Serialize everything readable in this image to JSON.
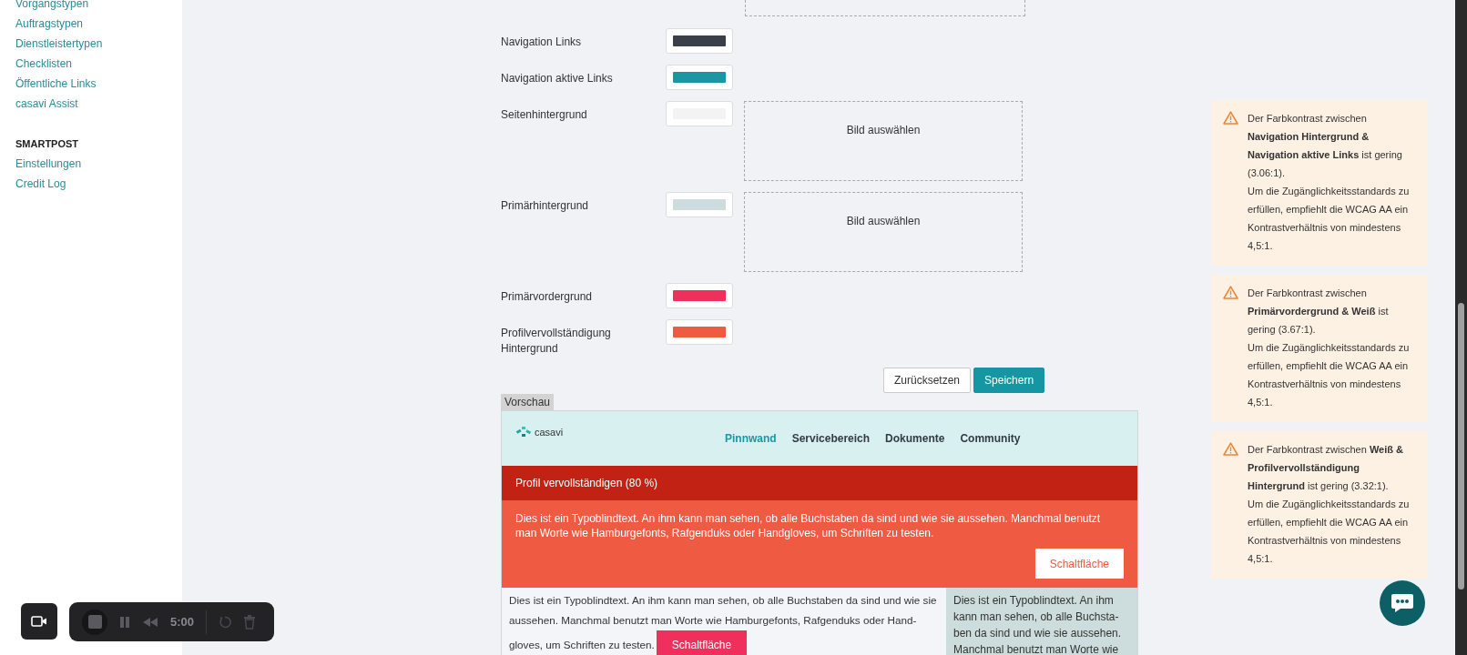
{
  "sidebar": {
    "groups": [
      {
        "items": [
          {
            "label": "Vorgangstypen"
          },
          {
            "label": "Auftragstypen"
          },
          {
            "label": "Dienstleistertypen"
          },
          {
            "label": "Checklisten"
          },
          {
            "label": "Öffentliche Links"
          },
          {
            "label": "casavi Assist"
          }
        ]
      },
      {
        "title": "SMARTPOST",
        "items": [
          {
            "label": "Einstellungen"
          },
          {
            "label": "Credit Log"
          }
        ]
      }
    ]
  },
  "cut_off_image_picker": true,
  "color_settings": [
    {
      "label": "Navigation Links",
      "color": "#3a3f4a"
    },
    {
      "label": "Navigation aktive Links",
      "color": "#1b96a3"
    },
    {
      "label": "Seitenhintergrund",
      "color": "#f3f3f3",
      "image_picker": {
        "label": "Bild auswählen"
      }
    },
    {
      "label": "Primärhintergrund",
      "color": "#cddcdc",
      "image_picker": {
        "label": "Bild auswählen"
      }
    },
    {
      "label": "Primärvordergrund",
      "color": "#ef2f5c"
    },
    {
      "label": "Profilvervollständigung Hintergrund",
      "color": "#ef5a42"
    }
  ],
  "buttons": [
    {
      "label": "Zurücksetzen",
      "kind": "secondary"
    },
    {
      "label": "Speichern",
      "kind": "primary"
    }
  ],
  "preview": {
    "tab_label": "Vorschau",
    "logo_text": "casavi",
    "nav": [
      {
        "label": "Pinnwand",
        "selected": true
      },
      {
        "label": "Servicebereich",
        "selected": false
      },
      {
        "label": "Dokumente",
        "selected": false
      },
      {
        "label": "Community",
        "selected": false
      }
    ],
    "profile_banner": {
      "title": "Profil vervollständigen (80 %)",
      "text": "Dies ist ein Typoblindtext. An ihm kann man sehen, ob alle Buchstaben da sind und wie sie aussehen. Manchmal benutzt man Worte wie Hamburgefonts, Rafgenduks oder Handgloves, um Schriften zu testen.",
      "button": "Schaltfläche"
    },
    "body_text": "Dies ist ein Typoblindtext. An ihm kann man sehen, ob alle Buchstaben da sind und wie sie aussehen. Manchmal benutzt man Worte wie Hamburgefonts, Rafgenduks oder Hand-",
    "body_text_end": "gloves, um Schriften zu testen.",
    "body_button": "Schaltfläche",
    "side_text": "Dies ist ein Typoblindtext. An ihm kann man sehen, ob alle Buchsta-ben da sind und wie sie aussehen. Manchmal benutzt man Worte wie"
  },
  "notices": [
    {
      "text": "Der Farbkontrast zwischen **Navigation Hintergrund & Navigation aktive Links** ist gering (3.06:1).",
      "advice": "Um die Zugänglichkeitsstandards zu erfüllen, empfiehlt die WCAG AA ein Kontrastverhältnis von mindestens 4,5:1."
    },
    {
      "text": "Der Farbkontrast zwischen **Primärvordergrund & Weiß** ist gering (3.67:1).",
      "advice": "Um die Zugänglichkeitsstandards zu erfüllen, empfiehlt die WCAG AA ein Kontrastverhältnis von mindestens 4,5:1."
    },
    {
      "text": "Der Farbkontrast zwischen **Weiß & Profilvervollständigung Hintergrund** ist gering (3.32:1).",
      "advice": "Um die Zugänglichkeitsstandards zu erfüllen, empfiehlt die WCAG AA ein Kontrastverhältnis von mindestens 4,5:1."
    }
  ],
  "recorder": {
    "time": "5:00"
  }
}
